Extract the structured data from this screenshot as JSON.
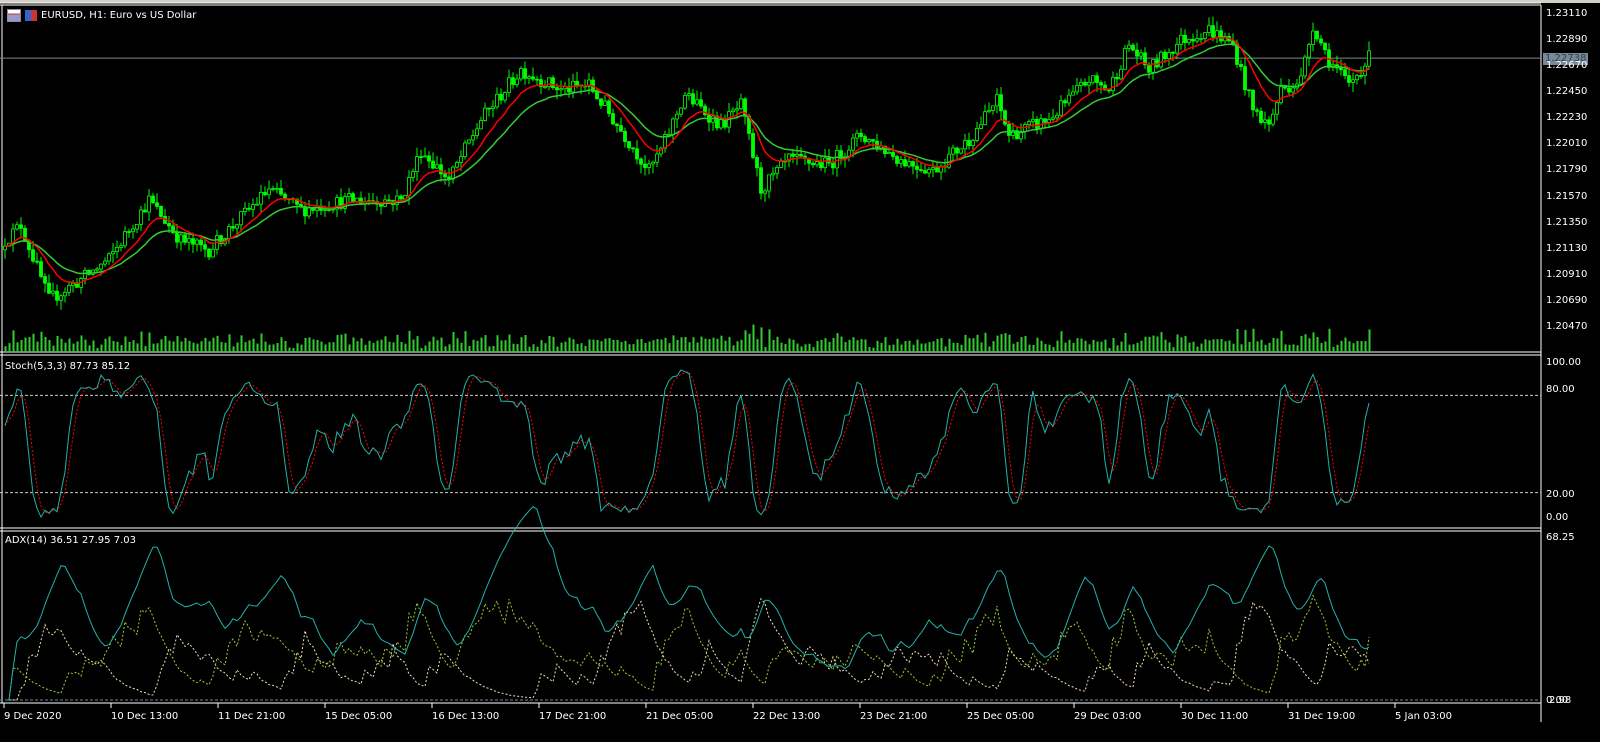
{
  "window": {
    "title": "EURUSD, H1:  Euro vs US Dollar"
  },
  "main": {
    "price_axis": [
      "1.23110",
      "1.22890",
      "1.22670",
      "1.22450",
      "1.22230",
      "1.22010",
      "1.21790",
      "1.21570",
      "1.21350",
      "1.21130",
      "1.20910",
      "1.20690",
      "1.20470"
    ],
    "current_price": "1.22738"
  },
  "stoch": {
    "label": "Stoch(5,3,3) 87.73 85.12",
    "axis": [
      "100.00",
      "80.00",
      "20.00",
      "0.00"
    ]
  },
  "adx": {
    "label": "ADX(14) 36.51 27.95 7.03",
    "axis_top": "68.25",
    "axis_bottom": "0.00",
    "axis_bottom2": "2.98"
  },
  "time_axis": [
    "9 Dec 2020",
    "10 Dec 13:00",
    "11 Dec 21:00",
    "15 Dec 05:00",
    "16 Dec 13:00",
    "17 Dec 21:00",
    "21 Dec 05:00",
    "22 Dec 13:00",
    "23 Dec 21:00",
    "25 Dec 05:00",
    "29 Dec 03:00",
    "30 Dec 11:00",
    "31 Dec 19:00",
    "5 Jan 03:00"
  ],
  "colors": {
    "bull": "#00ff00",
    "ma_fast": "#ff0000",
    "ma_slow": "#32cd32",
    "stoch_main": "#20b2aa",
    "stoch_signal": "#ff0000",
    "adx": "#20b2aa",
    "plus_di": "#9acd32",
    "minus_di": "#f5deb3",
    "volume": "#32cd32"
  },
  "chart_data": {
    "type": "candlestick",
    "symbol": "EURUSD",
    "timeframe": "H1",
    "ylim": [
      1.2047,
      1.2311
    ],
    "close_path": [
      [
        0,
        1.212
      ],
      [
        4,
        1.2133
      ],
      [
        11,
        1.207
      ],
      [
        19,
        1.2087
      ],
      [
        26,
        1.2104
      ],
      [
        36,
        1.2154
      ],
      [
        44,
        1.212
      ],
      [
        51,
        1.2112
      ],
      [
        66,
        1.2163
      ],
      [
        74,
        1.2146
      ],
      [
        86,
        1.2154
      ],
      [
        99,
        1.2154
      ],
      [
        104,
        1.2196
      ],
      [
        111,
        1.2171
      ],
      [
        119,
        1.2222
      ],
      [
        129,
        1.2264
      ],
      [
        139,
        1.2247
      ],
      [
        146,
        1.2251
      ],
      [
        154,
        1.2213
      ],
      [
        161,
        1.2179
      ],
      [
        164,
        1.2196
      ],
      [
        170,
        1.2243
      ],
      [
        179,
        1.2217
      ],
      [
        184,
        1.2234
      ],
      [
        189,
        1.2163
      ],
      [
        196,
        1.2188
      ],
      [
        206,
        1.2184
      ],
      [
        214,
        1.2209
      ],
      [
        224,
        1.2188
      ],
      [
        232,
        1.2179
      ],
      [
        241,
        1.2205
      ],
      [
        248,
        1.2238
      ],
      [
        251,
        1.2209
      ],
      [
        261,
        1.2222
      ],
      [
        271,
        1.2256
      ],
      [
        276,
        1.2247
      ],
      [
        281,
        1.2285
      ],
      [
        286,
        1.2264
      ],
      [
        294,
        1.2289
      ],
      [
        301,
        1.2298
      ],
      [
        307,
        1.2285
      ],
      [
        312,
        1.223
      ],
      [
        316,
        1.2217
      ],
      [
        319,
        1.2247
      ],
      [
        324,
        1.2256
      ],
      [
        327,
        1.2302
      ],
      [
        331,
        1.2272
      ],
      [
        336,
        1.2251
      ],
      [
        341,
        1.2274
      ]
    ],
    "last_values": {
      "stoch_main": 87.73,
      "stoch_signal": 85.12,
      "adx": 36.51,
      "plus_di": 27.95,
      "minus_di": 7.03
    }
  }
}
